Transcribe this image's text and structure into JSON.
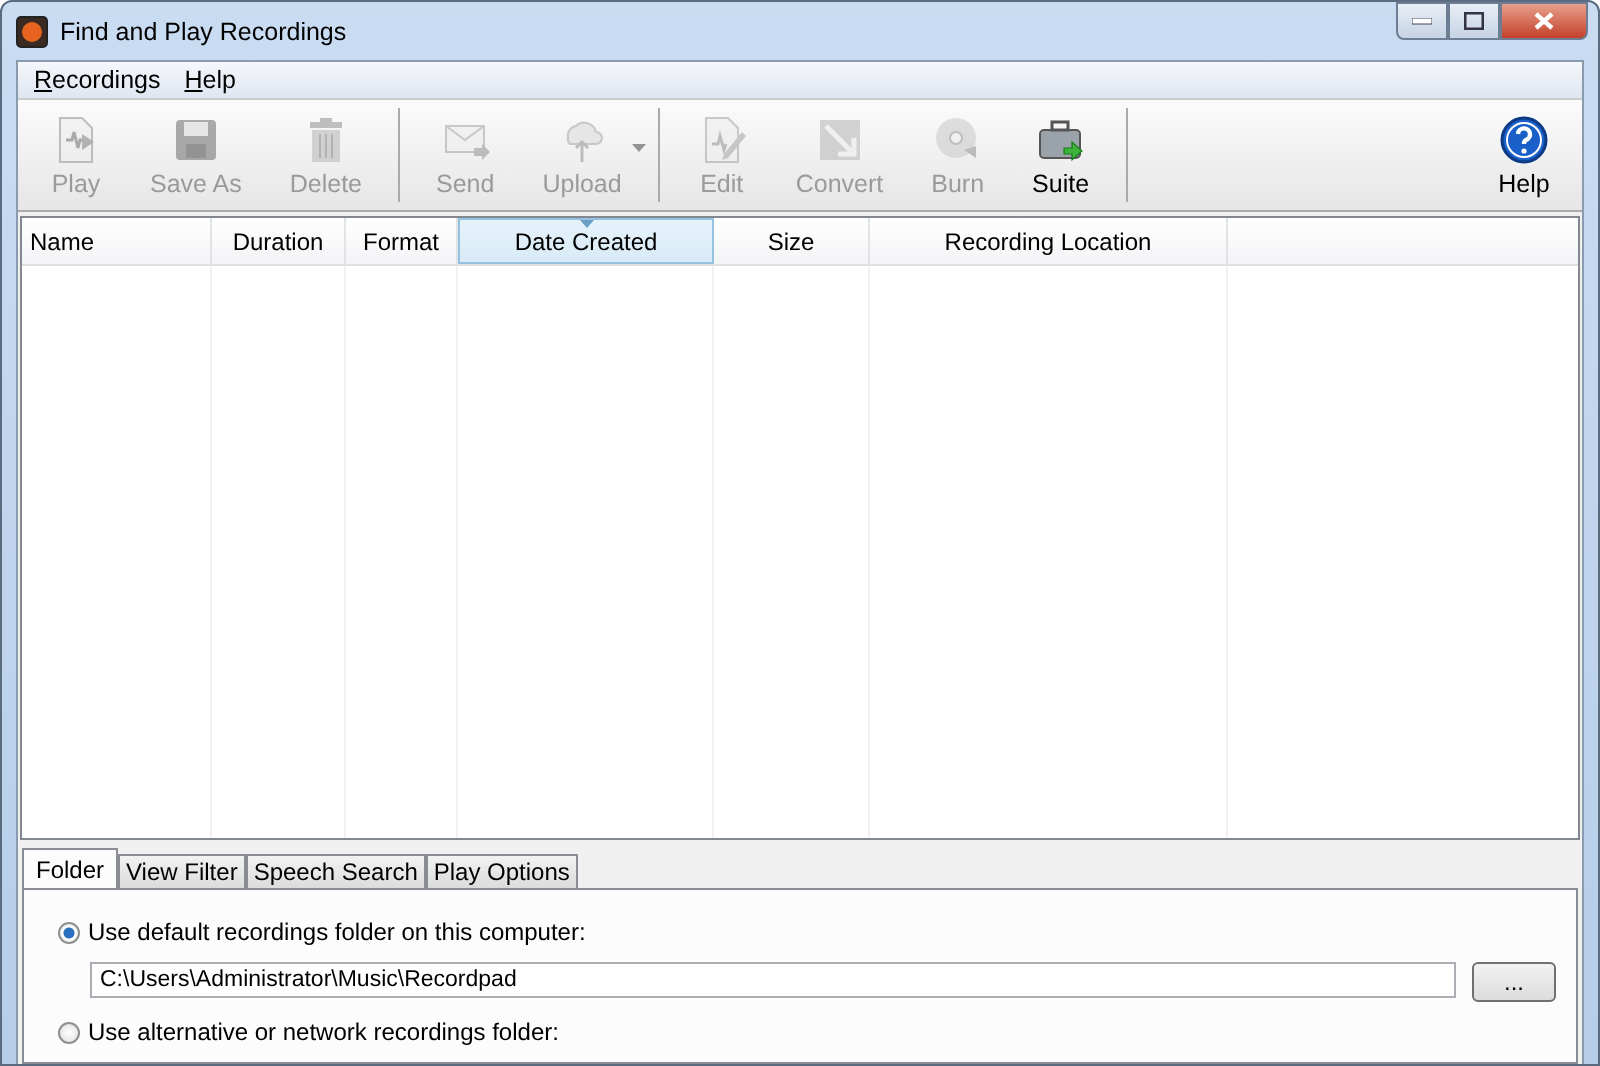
{
  "window": {
    "title": "Find and Play Recordings"
  },
  "menu": [
    {
      "label": "Recordings"
    },
    {
      "label": "Help"
    }
  ],
  "toolbar": [
    {
      "label": "Play",
      "disabled": true
    },
    {
      "label": "Save As",
      "disabled": true
    },
    {
      "label": "Delete",
      "disabled": true
    },
    {
      "label": "Send",
      "disabled": true
    },
    {
      "label": "Upload",
      "disabled": true
    },
    {
      "label": "Edit",
      "disabled": true
    },
    {
      "label": "Convert",
      "disabled": true
    },
    {
      "label": "Burn",
      "disabled": true
    },
    {
      "label": "Suite",
      "disabled": false
    }
  ],
  "help_button": {
    "label": "Help"
  },
  "table": {
    "columns": [
      {
        "label": "Name",
        "selected": false
      },
      {
        "label": "Duration",
        "selected": false
      },
      {
        "label": "Format",
        "selected": false
      },
      {
        "label": "Date Created",
        "selected": true
      },
      {
        "label": "Size",
        "selected": false
      },
      {
        "label": "Recording Location",
        "selected": false
      }
    ]
  },
  "tabs": [
    {
      "label": "Folder",
      "selected": true
    },
    {
      "label": "View Filter",
      "selected": false
    },
    {
      "label": "Speech Search",
      "selected": false
    },
    {
      "label": "Play Options",
      "selected": false
    }
  ],
  "folder_panel": {
    "options": [
      {
        "label": "Use default recordings folder on this computer:",
        "selected": true
      },
      {
        "label": "Use alternative or network recordings folder:",
        "selected": false
      }
    ],
    "path": "C:\\Users\\Administrator\\Music\\Recordpad",
    "browse_button": "..."
  }
}
